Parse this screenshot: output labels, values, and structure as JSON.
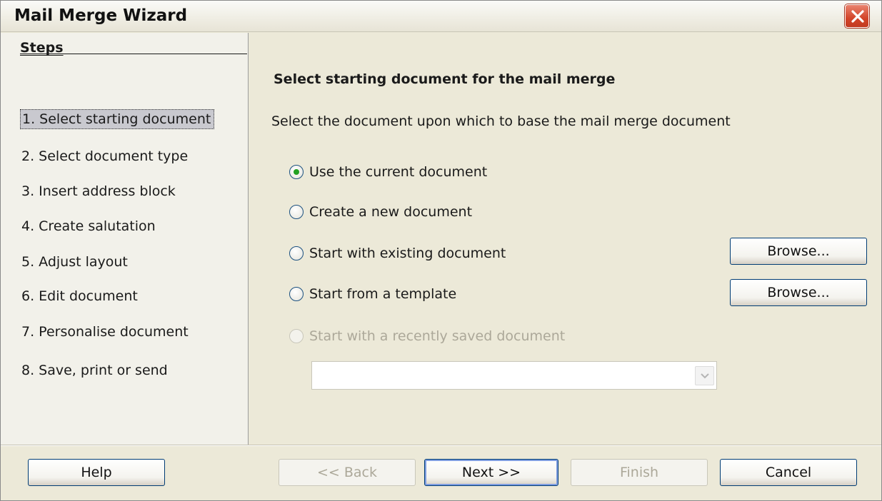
{
  "window": {
    "title": "Mail Merge Wizard"
  },
  "steps": {
    "heading": "Steps",
    "items": [
      {
        "label": "1. Select starting document",
        "active": true
      },
      {
        "label": "2. Select document type"
      },
      {
        "label": "3. Insert address block"
      },
      {
        "label": "4. Create salutation"
      },
      {
        "label": "5. Adjust layout"
      },
      {
        "label": "6. Edit document"
      },
      {
        "label": "7. Personalise document"
      },
      {
        "label": "8. Save, print or send"
      }
    ]
  },
  "main": {
    "heading": "Select starting document for the mail merge",
    "description": "Select the document upon which to base the mail merge document",
    "options": [
      {
        "label": "Use the current document",
        "checked": true
      },
      {
        "label": "Create a new document",
        "checked": false
      },
      {
        "label": "Start with existing document",
        "checked": false
      },
      {
        "label": "Start from a template",
        "checked": false
      },
      {
        "label": "Start with a recently saved document",
        "checked": false,
        "disabled": true
      }
    ],
    "browse_label": "Browse...",
    "recent_documents_value": ""
  },
  "footer": {
    "help": "Help",
    "back": "<< Back",
    "next": "Next >>",
    "finish": "Finish",
    "cancel": "Cancel"
  },
  "colors": {
    "dialog_bg": "#ece9d8",
    "radio_selected": "#21a121",
    "close_button": "#d3452a",
    "button_border": "#003c74"
  }
}
